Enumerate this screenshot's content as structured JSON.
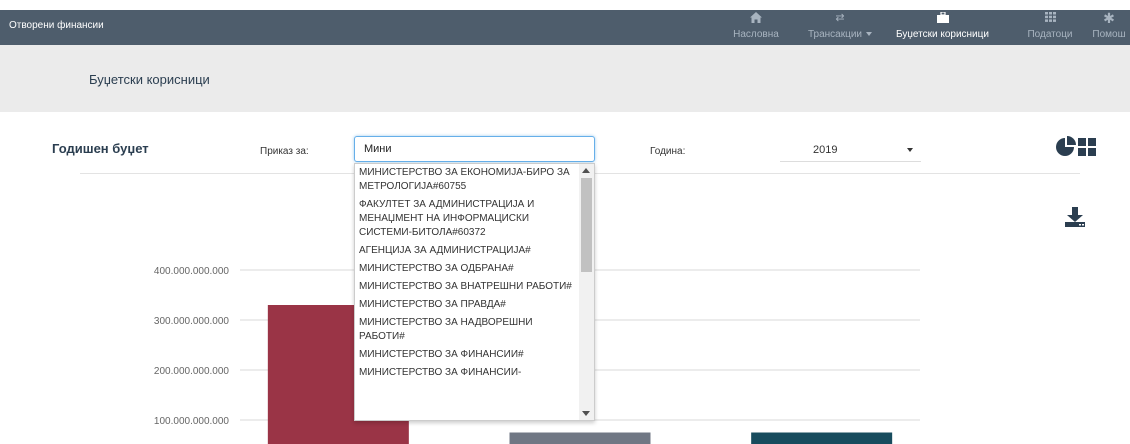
{
  "navbar": {
    "brand": "Отворени финансии",
    "items": [
      {
        "label": "Насловна",
        "icon": "home-icon"
      },
      {
        "label": "Трансакции",
        "icon": "transfer-icon",
        "dropdown": true
      },
      {
        "label": "Буџетски корисници",
        "icon": "briefcase-icon",
        "active": true
      },
      {
        "label": "Податоци",
        "icon": "grid-icon"
      },
      {
        "label": "Помош",
        "icon": "asterisk-icon"
      }
    ]
  },
  "subheader": {
    "title": "Буџетски корисници"
  },
  "filters": {
    "section_title": "Годишен буџет",
    "show_for_label": "Приказ за:",
    "search_value": "Мини",
    "year_label": "Година:",
    "year_value": "2019"
  },
  "autocomplete": {
    "options": [
      "МИНИСТЕРСТВО ЗА ЕКОНОМИЈА-БИРО ЗА МЕТРОЛОГИЈА#60755",
      "ФАКУЛТЕТ ЗА АДМИНИСТРАЦИЈА И МЕНАЏМЕНТ НА ИНФОРМАЦИСКИ СИСТЕМИ-БИТОЛА#60372",
      "АГЕНЦИЈА ЗА АДМИНИСТРАЦИЈА#",
      "МИНИСТЕРСТВО ЗА ОДБРАНА#",
      "МИНИСТЕРСТВО ЗА ВНАТРЕШНИ РАБОТИ#",
      "МИНИСТЕРСТВО ЗА ПРАВДА#",
      "МИНИСТЕРСТВО ЗА НАДВОРЕШНИ РАБОТИ#",
      "МИНИСТЕРСТВО ЗА ФИНАНСИИ#",
      "МИНИСТЕРСТВО ЗА ФИНАНСИИ-"
    ]
  },
  "icons": {
    "chart_type": "pie-chart-grid-icon",
    "download": "download-icon"
  },
  "chart_data": {
    "type": "bar",
    "ylim": [
      0,
      400000000000
    ],
    "yticks": [
      {
        "value": 100000000000,
        "label": "100.000.000.000"
      },
      {
        "value": 200000000000,
        "label": "200.000.000.000"
      },
      {
        "value": 300000000000,
        "label": "300.000.000.000"
      },
      {
        "value": 400000000000,
        "label": "400.000.000.000"
      }
    ],
    "bars": [
      {
        "value": 330000000000,
        "color": "#9a3446"
      },
      {
        "value": 75000000000,
        "color": "#707784"
      },
      {
        "value": 75000000000,
        "color": "#184c5e"
      }
    ]
  }
}
